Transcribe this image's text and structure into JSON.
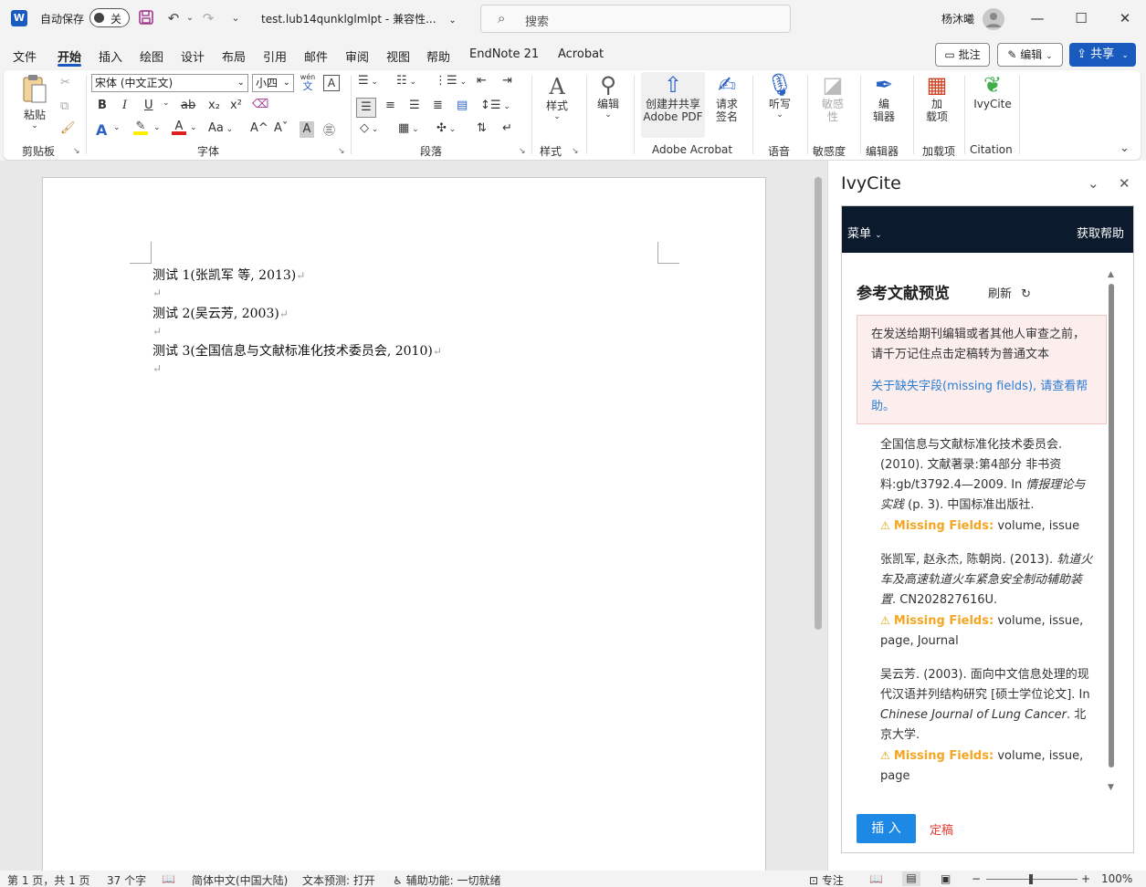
{
  "titlebar": {
    "app_icon": "W",
    "autosave_label": "自动保存",
    "autosave_state": "关",
    "filename": "test.lub14qunklglmlpt",
    "mode": "兼容性...",
    "search_placeholder": "搜索",
    "user_name": "杨沐曦"
  },
  "menu": {
    "tabs": [
      "文件",
      "开始",
      "插入",
      "绘图",
      "设计",
      "布局",
      "引用",
      "邮件",
      "审阅",
      "视图",
      "帮助",
      "EndNote 21",
      "Acrobat"
    ],
    "comment_label": "批注",
    "edit_label": "编辑",
    "share_label": "共享"
  },
  "ribbon": {
    "clipboard": {
      "paste_label": "粘贴",
      "group_label": "剪贴板"
    },
    "font": {
      "font_name": "宋体 (中文正文)",
      "font_size": "小四",
      "phonetic": "wén",
      "phonetic_char": "文",
      "bold": "B",
      "italic": "I",
      "underline": "U",
      "strike": "ab",
      "sub": "x₂",
      "sup": "x²",
      "case_label": "Aa",
      "grow": "A^",
      "shrink": "Aˇ",
      "char_shade": "A",
      "group_label": "字体"
    },
    "paragraph": {
      "group_label": "段落"
    },
    "styles": {
      "label": "样式",
      "group_label": "样式"
    },
    "editing": {
      "label": "编辑"
    },
    "acrobat": {
      "create_label_1": "创建并共享",
      "create_label_2": "Adobe PDF",
      "sign_label_1": "请求",
      "sign_label_2": "签名",
      "group_label": "Adobe Acrobat"
    },
    "voice": {
      "label": "听写",
      "group_label": "语音"
    },
    "sensitivity": {
      "label_1": "敏感",
      "label_2": "性",
      "group_label": "敏感度"
    },
    "editor": {
      "label_1": "编",
      "label_2": "辑器",
      "group_label": "编辑器"
    },
    "addins": {
      "label_1": "加",
      "label_2": "载项",
      "group_label": "加载项"
    },
    "citation": {
      "label": "IvyCite",
      "group_label": "Citation"
    }
  },
  "document": {
    "lines": [
      "测试 1(张凯军  等, 2013)",
      "测试 2(吴云芳, 2003)",
      "测试 3(全国信息与文献标准化技术委员会, 2010)"
    ],
    "para_mark": "↵"
  },
  "pane": {
    "title": "IvyCite",
    "menu_label": "菜单",
    "help_label": "获取帮助",
    "section_title": "参考文献预览",
    "refresh_label": "刷新",
    "warning_text": "在发送给期刊编辑或者其他人审查之前，请千万记住点击定稿转为普通文本",
    "warning_link": "关于缺失字段(missing fields), 请查看帮助。",
    "missing_label": "Missing Fields:",
    "references": [
      {
        "pre": "全国信息与文献标准化技术委员会. (2010). 文献著录:第4部分 非书资料:gb/t3792.4—2009. In ",
        "italic": "情报理论与实践",
        "post": " (p. 3). 中国标准出版社.",
        "missing": "volume, issue"
      },
      {
        "pre": "张凯军, 赵永杰, 陈朝岗. (2013). ",
        "italic": "轨道火车及高速轨道火车紧急安全制动辅助装置",
        "post": ". CN202827616U.",
        "missing": "volume, issue, page, Journal"
      },
      {
        "pre": "吴云芳. (2003). 面向中文信息处理的现代汉语并列结构研究 [硕士学位论文]. In ",
        "italic": "Chinese Journal of Lung Cancer",
        "post": ". 北京大学.",
        "missing": "volume, issue, page"
      }
    ],
    "insert_label": "插 入",
    "finalize_label": "定稿"
  },
  "status": {
    "page": "第 1 页，共 1 页",
    "words": "37 个字",
    "language": "简体中文(中国大陆)",
    "prediction": "文本预测: 打开",
    "accessibility": "辅助功能: 一切就绪",
    "focus": "专注",
    "zoom": "100%"
  },
  "colors": {
    "accent": "#185abd",
    "pane_nav": "#0c1a2e",
    "insert_button": "#1e88e5",
    "missing": "#f5a623",
    "finalize": "#e53935"
  }
}
